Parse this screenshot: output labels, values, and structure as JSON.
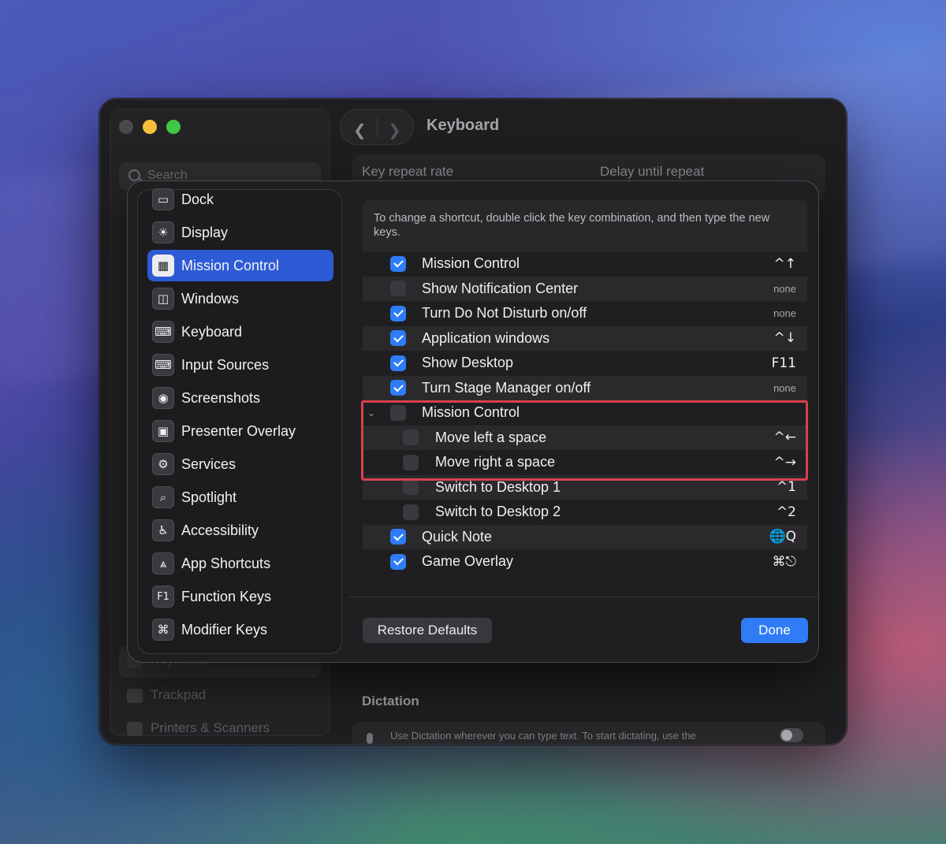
{
  "window": {
    "title": "Keyboard",
    "search_placeholder": "Search",
    "bg_sidebar": [
      "Keyboard",
      "Trackpad",
      "Printers & Scanners"
    ],
    "bg_labels": {
      "key_repeat": "Key repeat rate",
      "delay_repeat": "Delay until repeat"
    },
    "dictation": {
      "title": "Dictation",
      "text": "Use Dictation wherever you can type text. To start dictating, use the"
    }
  },
  "categories": [
    {
      "label": "Dock",
      "icon": "dock-icon",
      "glyph": "▭"
    },
    {
      "label": "Display",
      "icon": "display-brightness-icon",
      "glyph": "☀"
    },
    {
      "label": "Mission Control",
      "icon": "mission-control-icon",
      "glyph": "▦",
      "selected": true
    },
    {
      "label": "Windows",
      "icon": "windows-icon",
      "glyph": "◫"
    },
    {
      "label": "Keyboard",
      "icon": "keyboard-icon",
      "glyph": "⌨"
    },
    {
      "label": "Input Sources",
      "icon": "input-sources-icon",
      "glyph": "⌨"
    },
    {
      "label": "Screenshots",
      "icon": "camera-icon",
      "glyph": "◉"
    },
    {
      "label": "Presenter Overlay",
      "icon": "presenter-overlay-icon",
      "glyph": "▣"
    },
    {
      "label": "Services",
      "icon": "gears-icon",
      "glyph": "⚙"
    },
    {
      "label": "Spotlight",
      "icon": "magnifier-icon",
      "glyph": "⌕"
    },
    {
      "label": "Accessibility",
      "icon": "accessibility-icon",
      "glyph": "♿"
    },
    {
      "label": "App Shortcuts",
      "icon": "app-store-icon",
      "glyph": "⩓"
    },
    {
      "label": "Function Keys",
      "icon": "f1-key-icon",
      "glyph": "F1"
    },
    {
      "label": "Modifier Keys",
      "icon": "command-key-icon",
      "glyph": "⌘"
    }
  ],
  "instructions": "To change a shortcut, double click the key combination, and then type the new keys.",
  "shortcuts": [
    {
      "label": "Mission Control",
      "key": "^↑",
      "checked": true,
      "indent": 0
    },
    {
      "label": "Show Notification Center",
      "key": "none",
      "checked": false,
      "indent": 0
    },
    {
      "label": "Turn Do Not Disturb on/off",
      "key": "none",
      "checked": true,
      "indent": 0
    },
    {
      "label": "Application windows",
      "key": "^↓",
      "checked": true,
      "indent": 0
    },
    {
      "label": "Show Desktop",
      "key": "F11",
      "checked": true,
      "indent": 0
    },
    {
      "label": "Turn Stage Manager on/off",
      "key": "none",
      "checked": true,
      "indent": 0
    },
    {
      "label": "Mission Control",
      "key": "",
      "checked": false,
      "indent": 0,
      "disclosure": "⌄"
    },
    {
      "label": "Move left a space",
      "key": "^←",
      "checked": false,
      "indent": 1
    },
    {
      "label": "Move right a space",
      "key": "^→",
      "checked": false,
      "indent": 1
    },
    {
      "label": "Switch to Desktop 1",
      "key": "^1",
      "checked": false,
      "indent": 1
    },
    {
      "label": "Switch to Desktop 2",
      "key": "^2",
      "checked": false,
      "indent": 1
    },
    {
      "label": "Quick Note",
      "key": "🌐Q",
      "checked": true,
      "indent": 0
    },
    {
      "label": "Game Overlay",
      "key": "⌘⎋",
      "checked": true,
      "indent": 0
    }
  ],
  "buttons": {
    "restore": "Restore Defaults",
    "done": "Done"
  },
  "colors": {
    "accent": "#2f7cf6",
    "selection": "#2d5bd6",
    "highlight": "#d9404b"
  }
}
